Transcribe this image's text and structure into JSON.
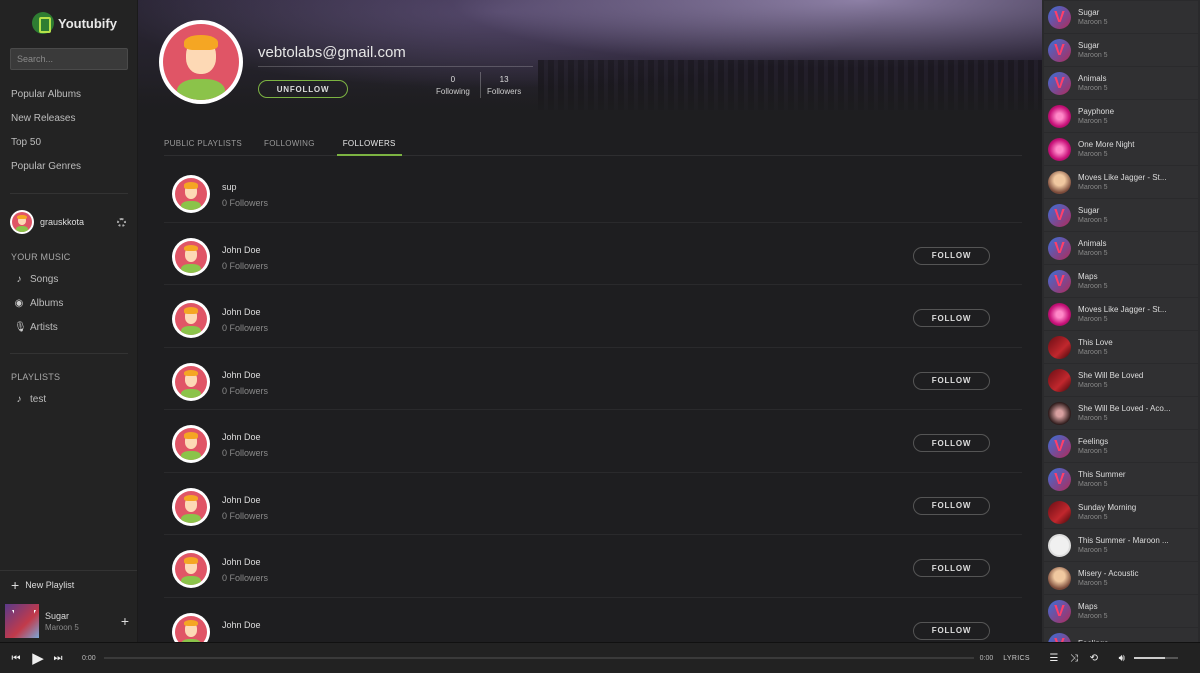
{
  "app": {
    "name": "Youtubify"
  },
  "search": {
    "placeholder": "Search..."
  },
  "nav": [
    "Popular Albums",
    "New Releases",
    "Top 50",
    "Popular Genres"
  ],
  "user": {
    "name": "grauskkota"
  },
  "your_music": {
    "heading": "YOUR MUSIC",
    "items": [
      {
        "label": "Songs",
        "icon": "note-icon"
      },
      {
        "label": "Albums",
        "icon": "disc-icon"
      },
      {
        "label": "Artists",
        "icon": "mic-icon"
      }
    ]
  },
  "playlists": {
    "heading": "PLAYLISTS",
    "items": [
      {
        "label": "test",
        "icon": "note-icon"
      }
    ]
  },
  "new_playlist": "New Playlist",
  "now_playing": {
    "title": "Sugar",
    "artist": "Maroon 5"
  },
  "profile": {
    "email": "vebtolabs@gmail.com",
    "unfollow_label": "UNFOLLOW",
    "following_count": "0",
    "following_label": "Following",
    "followers_count": "13",
    "followers_label": "Followers"
  },
  "tabs": [
    {
      "label": "PUBLIC PLAYLISTS",
      "active": false
    },
    {
      "label": "FOLLOWING",
      "active": false
    },
    {
      "label": "FOLLOWERS",
      "active": true
    }
  ],
  "followers": [
    {
      "name": "sup",
      "followers": "0 Followers",
      "follow_label": ""
    },
    {
      "name": "John Doe",
      "followers": "0 Followers",
      "follow_label": "FOLLOW"
    },
    {
      "name": "John Doe",
      "followers": "0 Followers",
      "follow_label": "FOLLOW"
    },
    {
      "name": "John Doe",
      "followers": "0 Followers",
      "follow_label": "FOLLOW"
    },
    {
      "name": "John Doe",
      "followers": "0 Followers",
      "follow_label": "FOLLOW"
    },
    {
      "name": "John Doe",
      "followers": "0 Followers",
      "follow_label": "FOLLOW"
    },
    {
      "name": "John Doe",
      "followers": "0 Followers",
      "follow_label": "FOLLOW"
    },
    {
      "name": "John Doe",
      "followers": "",
      "follow_label": "FOLLOW"
    }
  ],
  "queue": [
    {
      "title": "Sugar",
      "artist": "Maroon 5",
      "art": "art-v"
    },
    {
      "title": "Sugar",
      "artist": "Maroon 5",
      "art": "art-v"
    },
    {
      "title": "Animals",
      "artist": "Maroon 5",
      "art": "art-v"
    },
    {
      "title": "Payphone",
      "artist": "Maroon 5",
      "art": "art-pink"
    },
    {
      "title": "One More Night",
      "artist": "Maroon 5",
      "art": "art-pink"
    },
    {
      "title": "Moves Like Jagger - St...",
      "artist": "Maroon 5",
      "art": "art-face"
    },
    {
      "title": "Sugar",
      "artist": "Maroon 5",
      "art": "art-v"
    },
    {
      "title": "Animals",
      "artist": "Maroon 5",
      "art": "art-v"
    },
    {
      "title": "Maps",
      "artist": "Maroon 5",
      "art": "art-v"
    },
    {
      "title": "Moves Like Jagger - St...",
      "artist": "Maroon 5",
      "art": "art-pink"
    },
    {
      "title": "This Love",
      "artist": "Maroon 5",
      "art": "art-red"
    },
    {
      "title": "She Will Be Loved",
      "artist": "Maroon 5",
      "art": "art-red"
    },
    {
      "title": "She Will Be Loved - Aco...",
      "artist": "Maroon 5",
      "art": "art-dark"
    },
    {
      "title": "Feelings",
      "artist": "Maroon 5",
      "art": "art-v"
    },
    {
      "title": "This Summer",
      "artist": "Maroon 5",
      "art": "art-v"
    },
    {
      "title": "Sunday Morning",
      "artist": "Maroon 5",
      "art": "art-red"
    },
    {
      "title": "This Summer - Maroon ...",
      "artist": "Maroon 5",
      "art": "art-white"
    },
    {
      "title": "Misery - Acoustic",
      "artist": "Maroon 5",
      "art": "art-face"
    },
    {
      "title": "Maps",
      "artist": "Maroon 5",
      "art": "art-v"
    },
    {
      "title": "Feelings",
      "artist": "",
      "art": "art-v"
    }
  ],
  "player": {
    "current_time": "0:00",
    "duration": "0:00",
    "lyrics_label": "LYRICS",
    "volume": 0.7
  },
  "colors": {
    "accent": "#7cb342",
    "avatar_bg": "#e05566"
  }
}
